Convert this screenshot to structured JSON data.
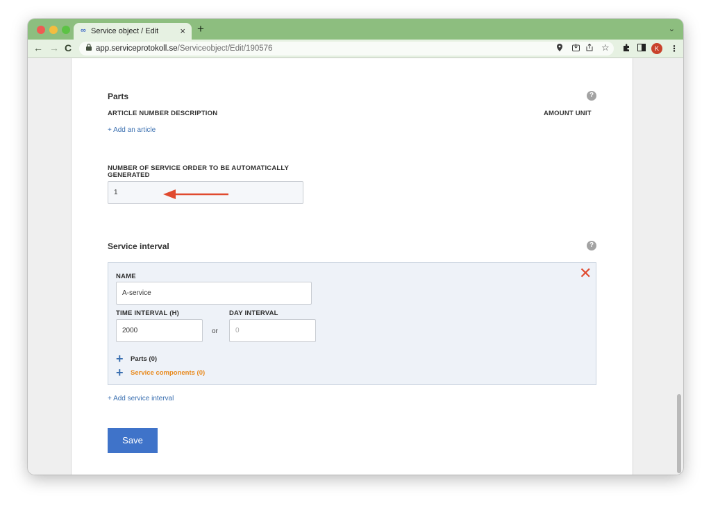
{
  "browser": {
    "tab": {
      "title": "Service object / Edit",
      "close": "×",
      "icon": "∞"
    },
    "new_tab": "+",
    "tab_menu": "⌄",
    "nav": {
      "back": "←",
      "forward": "→",
      "reload": "C"
    },
    "url_host": "app.serviceprotokoll.se",
    "url_path": "/Serviceobject/Edit/190576",
    "avatar": "K",
    "menu": "⋮",
    "colors": {
      "tabbar": "#8dbe7f",
      "toolbar": "#e6f1e2"
    }
  },
  "parts": {
    "title": "Parts",
    "help": "?",
    "col_article": "ARTICLE NUMBER DESCRIPTION",
    "col_amount": "AMOUNT UNIT",
    "add_article": "+ Add an article"
  },
  "auto_orders": {
    "label_line1": "NUMBER OF SERVICE ORDER TO BE AUTOMATICALLY",
    "label_line2": "GENERATED",
    "value": "1"
  },
  "service_interval": {
    "title": "Service interval",
    "help": "?",
    "remove": "✕",
    "name_label": "NAME",
    "name_value": "A-service",
    "time_label": "TIME INTERVAL (H)",
    "time_value": "2000",
    "or": "or",
    "day_label": "DAY INTERVAL",
    "day_placeholder": "0",
    "plus": "+",
    "parts_toggle": "Parts (0)",
    "components_toggle": "Service components (0)",
    "add_interval": "+ Add service interval"
  },
  "save": "Save"
}
